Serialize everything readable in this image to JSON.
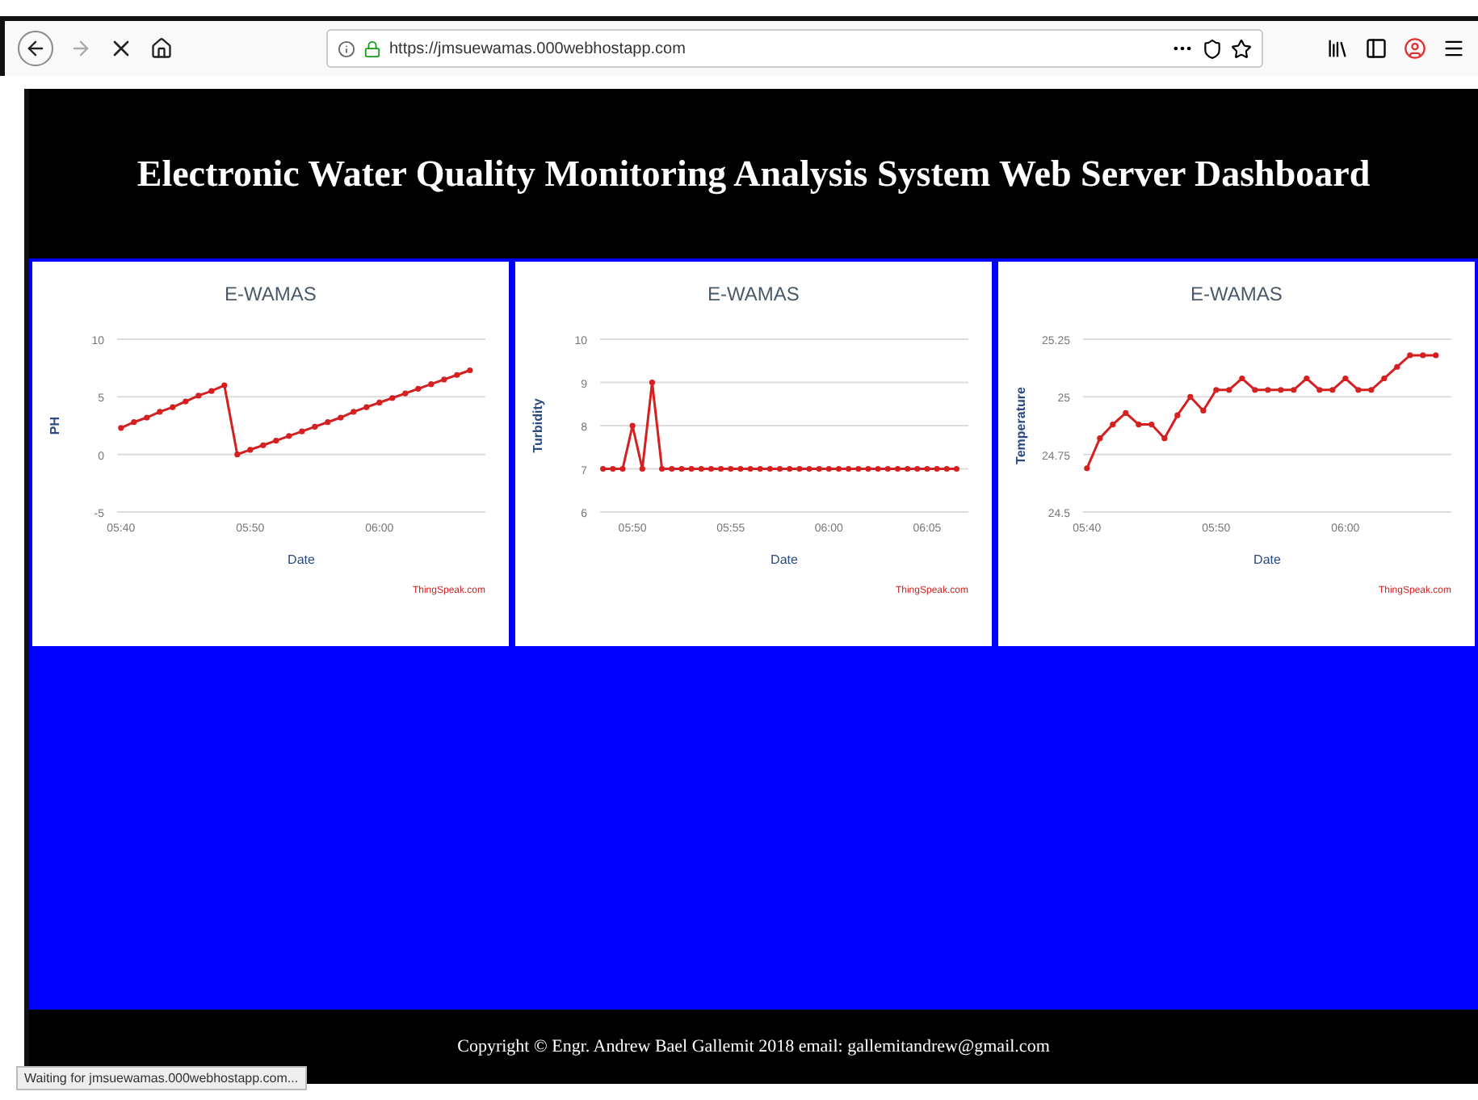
{
  "browser": {
    "url": "https://jmsuewamas.000webhostapp.com",
    "status": "Waiting for jmsuewamas.000webhostapp.com..."
  },
  "header": {
    "title": "Electronic Water Quality Monitoring Analysis System Web Server Dashboard"
  },
  "charts": [
    {
      "credit": "ThingSpeak.com",
      "chart_data": {
        "type": "line",
        "title": "E-WAMAS",
        "grid": true,
        "xlabel": "Date",
        "ylabel": "PH",
        "ylim": [
          -5,
          10
        ],
        "yticks": [
          10,
          5,
          0,
          -5
        ],
        "categories": [
          "05:40",
          null,
          null,
          null,
          null,
          null,
          null,
          null,
          null,
          null,
          "05:50",
          null,
          null,
          null,
          null,
          null,
          null,
          null,
          null,
          null,
          "06:00",
          null,
          null,
          null,
          null,
          null,
          null,
          null
        ],
        "series": [
          {
            "color": "#d42020",
            "marker": true,
            "values": [
              2.3,
              2.8,
              3.2,
              3.7,
              4.1,
              4.6,
              5.1,
              5.5,
              6.0,
              0.0,
              0.4,
              0.8,
              1.2,
              1.6,
              2.0,
              2.4,
              2.8,
              3.2,
              3.7,
              4.1,
              4.5,
              4.9,
              5.3,
              5.7,
              6.1,
              6.5,
              6.9,
              7.3
            ]
          }
        ]
      }
    },
    {
      "credit": "ThingSpeak.com",
      "chart_data": {
        "type": "line",
        "title": "E-WAMAS",
        "xlabel": "Date",
        "ylabel": "Turbidity",
        "grid": true,
        "ylim": [
          6,
          10
        ],
        "yticks": [
          10,
          9,
          8,
          7,
          6
        ],
        "categories": [
          null,
          null,
          null,
          "05:50",
          null,
          null,
          null,
          null,
          null,
          null,
          null,
          null,
          null,
          "05:55",
          null,
          null,
          null,
          null,
          null,
          null,
          null,
          null,
          null,
          "06:00",
          null,
          null,
          null,
          null,
          null,
          null,
          null,
          null,
          null,
          "06:05",
          null,
          null,
          null
        ],
        "series": [
          {
            "color": "#d42020",
            "marker": true,
            "values": [
              7,
              7,
              7,
              8,
              7,
              9,
              7,
              7,
              7,
              7,
              7,
              7,
              7,
              7,
              7,
              7,
              7,
              7,
              7,
              7,
              7,
              7,
              7,
              7,
              7,
              7,
              7,
              7,
              7,
              7,
              7,
              7,
              7,
              7,
              7,
              7,
              7
            ]
          }
        ]
      }
    },
    {
      "credit": "ThingSpeak.com",
      "chart_data": {
        "type": "line",
        "title": "E-WAMAS",
        "xlabel": "Date",
        "ylabel": "Temperature",
        "grid": true,
        "ylim": [
          24.5,
          25.25
        ],
        "yticks": [
          25.25,
          25,
          24.75,
          24.5
        ],
        "categories": [
          "05:40",
          null,
          null,
          null,
          null,
          null,
          null,
          null,
          null,
          null,
          "05:50",
          null,
          null,
          null,
          null,
          null,
          null,
          null,
          null,
          null,
          "06:00",
          null,
          null,
          null,
          null,
          null,
          null,
          null
        ],
        "series": [
          {
            "color": "#d42020",
            "marker": true,
            "values": [
              24.69,
              24.82,
              24.88,
              24.93,
              24.88,
              24.88,
              24.82,
              24.92,
              25,
              24.94,
              25.03,
              25.03,
              25.08,
              25.03,
              25.03,
              25.03,
              25.03,
              25.08,
              25.03,
              25.03,
              25.08,
              25.03,
              25.03,
              25.08,
              25.13,
              25.18,
              25.18,
              25.18
            ]
          }
        ]
      }
    }
  ],
  "footer": {
    "text": "Copyright © Engr. Andrew Bael Gallemit 2018 email: gallemitandrew@gmail.com"
  }
}
